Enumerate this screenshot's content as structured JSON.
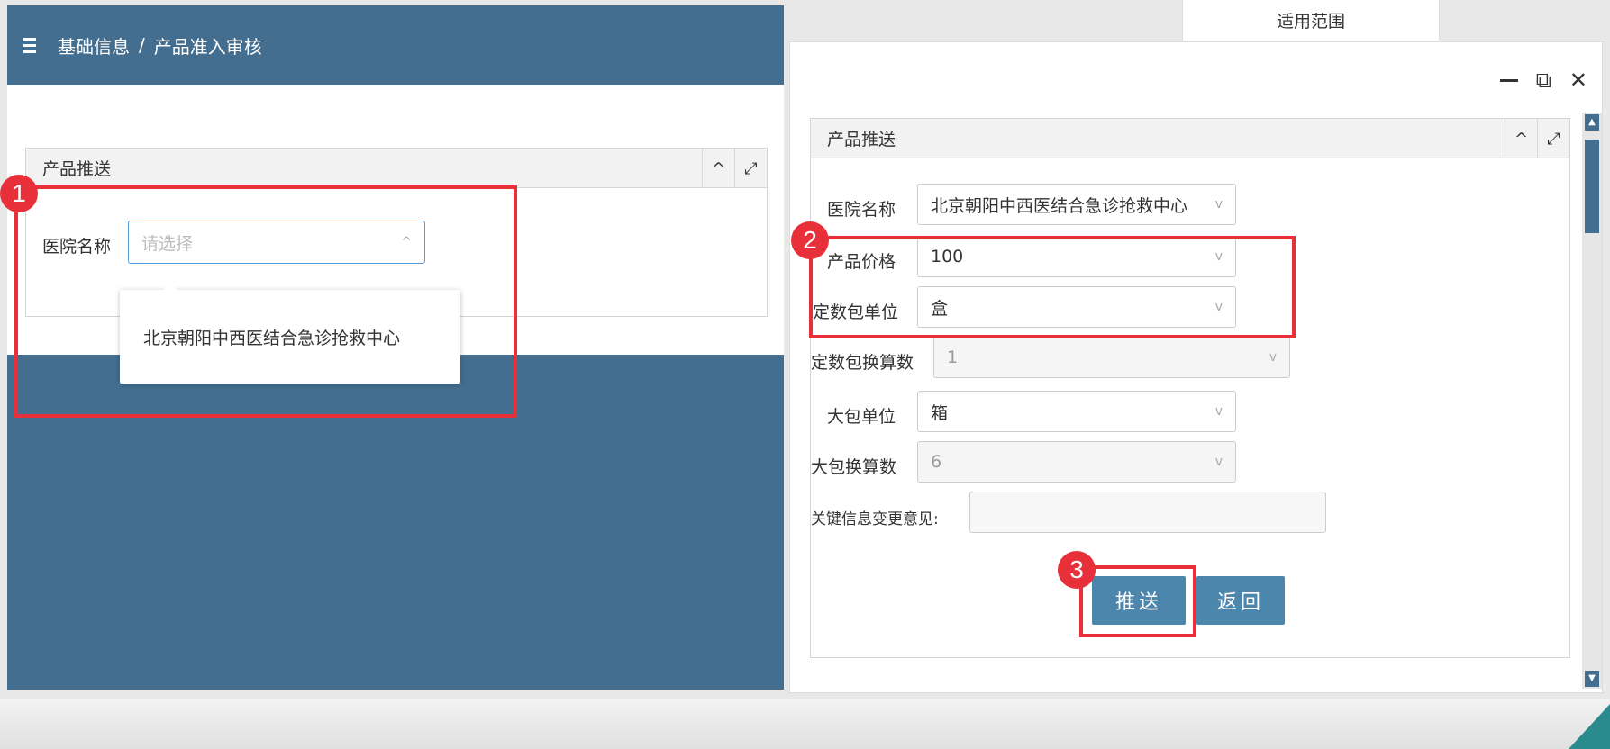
{
  "left": {
    "breadcrumb": {
      "root": "基础信息",
      "separator": "/",
      "current": "产品准入审核"
    },
    "panel_title": "产品推送",
    "field_label": "医院名称",
    "select_placeholder": "请选择",
    "dropdown_option": "北京朝阳中西医结合急诊抢救中心"
  },
  "right": {
    "top_tab": "适用范围",
    "panel_title": "产品推送",
    "fields": [
      {
        "label": "医院名称",
        "value": "北京朝阳中西医结合急诊抢救中心",
        "disabled": false
      },
      {
        "label": "产品价格",
        "value": "100",
        "disabled": false
      },
      {
        "label": "定数包单位",
        "value": "盒",
        "disabled": false
      },
      {
        "label": "定数包换算数",
        "value": "1",
        "disabled": true
      },
      {
        "label": "大包单位",
        "value": "箱",
        "disabled": false
      },
      {
        "label": "大包换算数",
        "value": "6",
        "disabled": true
      },
      {
        "label": "关键信息变更意见:",
        "value": "",
        "disabled": false
      }
    ],
    "push_button": "推送",
    "back_button": "返回"
  },
  "badges": [
    "1",
    "2",
    "3"
  ],
  "colors": {
    "header": "#446e8f",
    "button": "#4d86ad",
    "highlight": "#e8303a"
  }
}
